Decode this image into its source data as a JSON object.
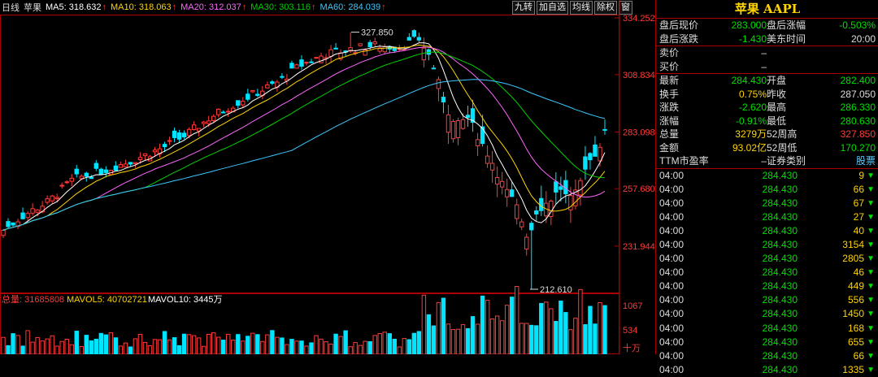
{
  "header": {
    "period": "日线",
    "name": "苹果",
    "ma": [
      {
        "label": "MA5: 318.632",
        "color": "#ffffff"
      },
      {
        "label": "MA10: 318.063",
        "color": "#ffd400"
      },
      {
        "label": "MA20: 312.037",
        "color": "#ff66ff"
      },
      {
        "label": "MA30: 303.116",
        "color": "#00d000"
      },
      {
        "label": "MA60: 284.039",
        "color": "#3cc8ff"
      }
    ],
    "buttons": [
      "九转",
      "加自选",
      "均线",
      "除权",
      "窗"
    ]
  },
  "price_axis": [
    "334.252",
    "308.834",
    "283.098",
    "257.680",
    "231.944"
  ],
  "annotations": {
    "high": "327.850",
    "low": "212.610"
  },
  "volume_header": {
    "total": "总量: 31685808",
    "mavol5": "MAVOL5: 40702721",
    "mavol10": "MAVOL10: 3445万"
  },
  "volume_axis": [
    "1067",
    "534",
    "十万"
  ],
  "chart_data": {
    "type": "candlestick",
    "ylim": [
      212.61,
      334.252
    ],
    "high": 327.85,
    "low": 212.61,
    "volume_unit": "十万",
    "volume_ylim": [
      0,
      1067
    ]
  },
  "panel": {
    "title": "苹果 AAPL",
    "after_hours": [
      {
        "l1": "盘后现价",
        "v1": "283.000",
        "c1": "g",
        "l2": "盘后涨幅",
        "v2": "-0.503%",
        "c2": "g"
      },
      {
        "l1": "盘后涨跌",
        "v1": "-1.430",
        "c1": "g",
        "l2": "美东时间",
        "v2": "20:00",
        "c2": "w"
      }
    ],
    "book": [
      {
        "l1": "卖价",
        "v1": "–",
        "c1": "w"
      },
      {
        "l1": "买价",
        "v1": "–",
        "c1": "w"
      }
    ],
    "stats": [
      {
        "l1": "最新",
        "v1": "284.430",
        "c1": "g",
        "l2": "开盘",
        "v2": "282.400",
        "c2": "g"
      },
      {
        "l1": "换手",
        "v1": "0.75%",
        "c1": "y",
        "l2": "昨收",
        "v2": "287.050",
        "c2": "w"
      },
      {
        "l1": "涨跌",
        "v1": "-2.620",
        "c1": "g",
        "l2": "最高",
        "v2": "286.330",
        "c2": "g"
      },
      {
        "l1": "涨幅",
        "v1": "-0.91%",
        "c1": "g",
        "l2": "最低",
        "v2": "280.630",
        "c2": "g"
      },
      {
        "l1": "总量",
        "v1": "3279万",
        "c1": "y",
        "l2": "52周高",
        "v2": "327.850",
        "c2": "r"
      },
      {
        "l1": "金额",
        "v1": "93.02亿",
        "c1": "y",
        "l2": "52周低",
        "v2": "170.270",
        "c2": "g"
      },
      {
        "l1": "TTM市盈率",
        "v1": "–",
        "c1": "w",
        "l2": "证券类别",
        "v2": "股票",
        "c2": "b"
      }
    ],
    "trades": [
      {
        "time": "04:00",
        "price": "284.430",
        "qty": "9"
      },
      {
        "time": "04:00",
        "price": "284.430",
        "qty": "66"
      },
      {
        "time": "04:00",
        "price": "284.430",
        "qty": "67"
      },
      {
        "time": "04:00",
        "price": "284.430",
        "qty": "27"
      },
      {
        "time": "04:00",
        "price": "284.430",
        "qty": "40"
      },
      {
        "time": "04:00",
        "price": "284.430",
        "qty": "3154"
      },
      {
        "time": "04:00",
        "price": "284.430",
        "qty": "2805"
      },
      {
        "time": "04:00",
        "price": "284.430",
        "qty": "46"
      },
      {
        "time": "04:00",
        "price": "284.430",
        "qty": "449"
      },
      {
        "time": "04:00",
        "price": "284.430",
        "qty": "556"
      },
      {
        "time": "04:00",
        "price": "284.430",
        "qty": "1450"
      },
      {
        "time": "04:00",
        "price": "284.430",
        "qty": "168"
      },
      {
        "time": "04:00",
        "price": "284.430",
        "qty": "655"
      },
      {
        "time": "04:00",
        "price": "284.430",
        "qty": "66"
      },
      {
        "time": "04:00",
        "price": "284.430",
        "qty": "1335"
      }
    ]
  }
}
